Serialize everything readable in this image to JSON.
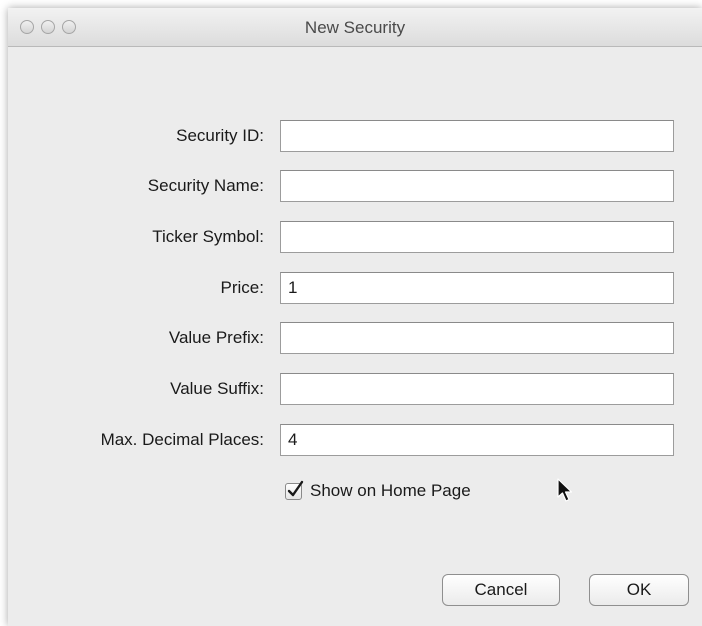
{
  "window": {
    "title": "New Security"
  },
  "form": {
    "fields": [
      {
        "label": "Security ID:",
        "value": ""
      },
      {
        "label": "Security Name:",
        "value": ""
      },
      {
        "label": "Ticker Symbol:",
        "value": ""
      },
      {
        "label": "Price:",
        "value": "1"
      },
      {
        "label": "Value Prefix:",
        "value": ""
      },
      {
        "label": "Value Suffix:",
        "value": ""
      },
      {
        "label": "Max. Decimal Places:",
        "value": "4"
      }
    ],
    "show_on_home_page": {
      "label": "Show on Home Page",
      "checked": true
    }
  },
  "buttons": {
    "cancel": "Cancel",
    "ok": "OK"
  },
  "icons": {
    "window_controls": [
      "close-icon",
      "minimize-icon",
      "zoom-icon"
    ],
    "checkmark": "checkmark-icon",
    "cursor": "mouse-pointer-icon"
  }
}
